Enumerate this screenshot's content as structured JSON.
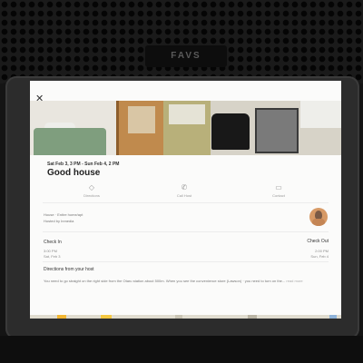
{
  "listing": {
    "dates": "Sat Feb 3, 3 PM - Sun Feb 4, 2 PM",
    "title": "Good house",
    "type": "House · Entire home/apt",
    "host": "Hosted by Inmedia"
  },
  "actions": [
    {
      "label": "Directions",
      "icon": "diamond-directions-icon"
    },
    {
      "label": "Call Host",
      "icon": "phone-icon"
    },
    {
      "label": "Contact",
      "icon": "chat-icon"
    }
  ],
  "check_in": {
    "label": "Check In",
    "time": "3:00 PM",
    "date": "Sat, Feb 3"
  },
  "check_out": {
    "label": "Check Out",
    "time": "2:00 PM",
    "date": "Sun, Feb 4"
  },
  "directions": {
    "heading": "Directions from your host",
    "text": "You need to go straight on the right side from the Otaru station about 500m. When you see the convenience store (Lawson) · you need to turn on the...",
    "read_more": "read more"
  },
  "stand_logo": "FAVS",
  "colors": {
    "accent": "#ff5a5f",
    "screen_bg": "#fbfbfa"
  }
}
